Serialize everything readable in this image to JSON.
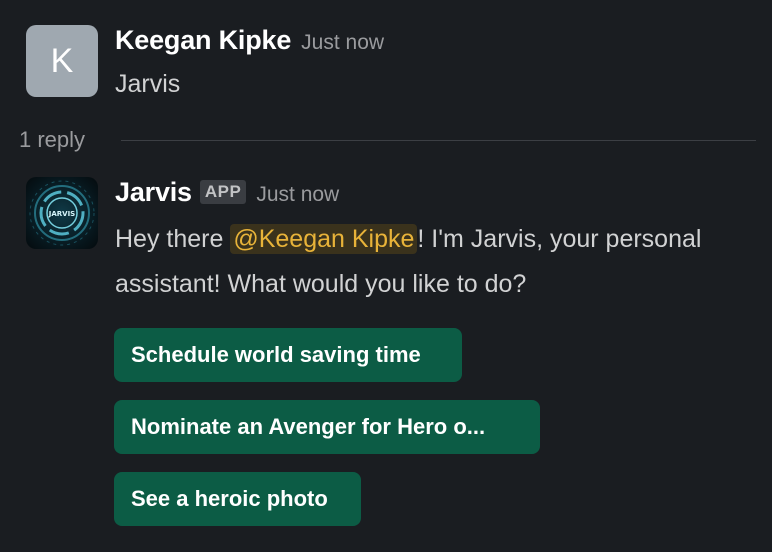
{
  "message1": {
    "avatar_initial": "K",
    "author": "Keegan Kipke",
    "time": "Just now",
    "text": "Jarvis"
  },
  "thread": {
    "reply_count_label": "1 reply"
  },
  "message2": {
    "avatar_label": "JARVIS",
    "author": "Jarvis",
    "badge": "APP",
    "time": "Just now",
    "text_before": "Hey there ",
    "mention": "@Keegan Kipke",
    "text_after": "! I'm Jarvis, your personal assistant! What would you like to do?"
  },
  "buttons": [
    {
      "label": "Schedule world saving time"
    },
    {
      "label": "Nominate an Avenger for Hero o..."
    },
    {
      "label": "See a heroic photo"
    }
  ],
  "colors": {
    "background": "#1a1d21",
    "button": "#0c5c45",
    "mention_text": "#e8b339",
    "mention_bg": "#3a321c"
  }
}
